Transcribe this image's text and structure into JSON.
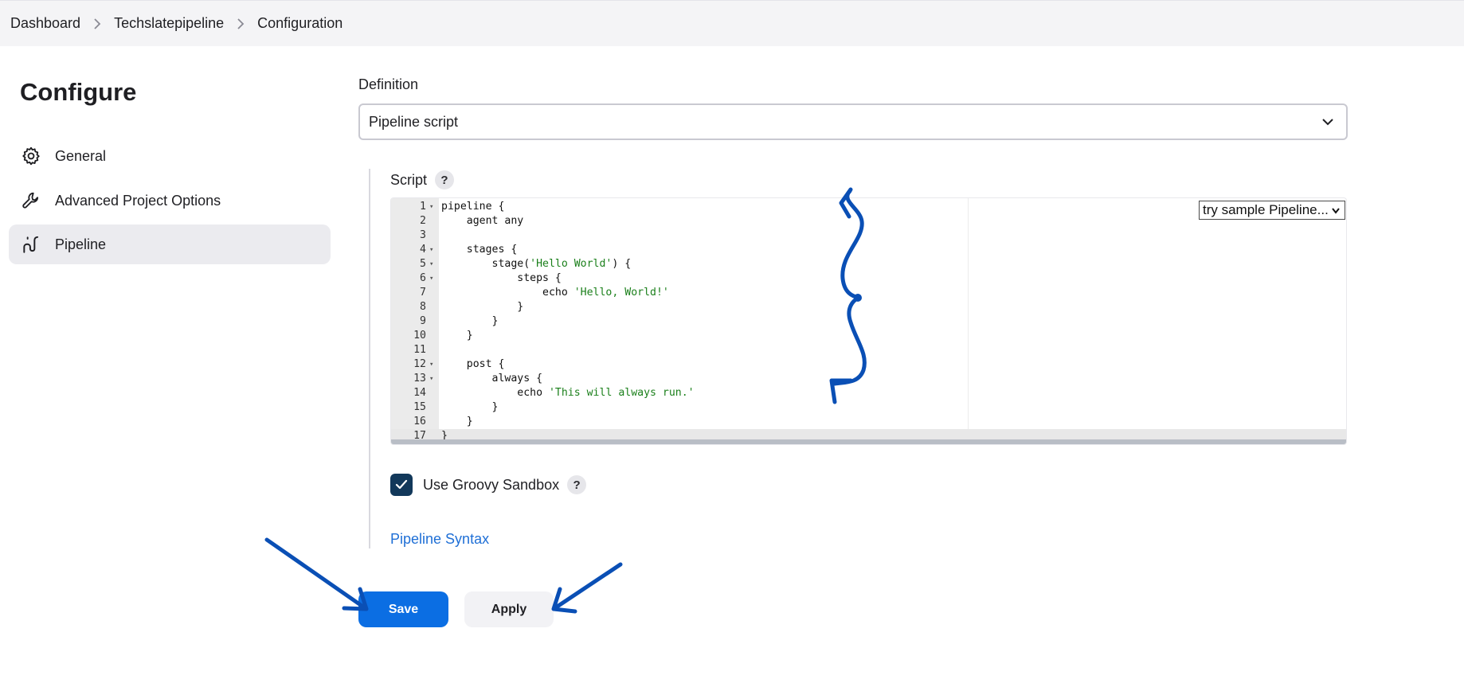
{
  "breadcrumb": {
    "items": [
      "Dashboard",
      "Techslatepipeline",
      "Configuration"
    ]
  },
  "sidebar": {
    "title": "Configure",
    "items": [
      {
        "label": "General",
        "icon": "gear-icon"
      },
      {
        "label": "Advanced Project Options",
        "icon": "wrench-icon"
      },
      {
        "label": "Pipeline",
        "icon": "pipeline-icon",
        "active": true
      }
    ]
  },
  "definition": {
    "label": "Definition",
    "selected": "Pipeline script"
  },
  "script": {
    "label": "Script",
    "help": "?",
    "sample_select": "try sample Pipeline...",
    "lines": [
      {
        "n": "1",
        "code": "pipeline {"
      },
      {
        "n": "2",
        "code": "    agent any"
      },
      {
        "n": "3",
        "code": ""
      },
      {
        "n": "4",
        "code": "    stages {"
      },
      {
        "n": "5",
        "code": "        stage('Hello World') {"
      },
      {
        "n": "6",
        "code": "            steps {"
      },
      {
        "n": "7",
        "code": "                echo 'Hello, World!'"
      },
      {
        "n": "8",
        "code": "            }"
      },
      {
        "n": "9",
        "code": "        }"
      },
      {
        "n": "10",
        "code": "    }"
      },
      {
        "n": "11",
        "code": ""
      },
      {
        "n": "12",
        "code": "    post {"
      },
      {
        "n": "13",
        "code": "        always {"
      },
      {
        "n": "14",
        "code": "            echo 'This will always run.'"
      },
      {
        "n": "15",
        "code": "        }"
      },
      {
        "n": "16",
        "code": "    }"
      },
      {
        "n": "17",
        "code": "}"
      }
    ]
  },
  "sandbox": {
    "label": "Use Groovy Sandbox",
    "checked": true,
    "help": "?"
  },
  "pipeline_syntax_link": "Pipeline Syntax",
  "buttons": {
    "save": "Save",
    "apply": "Apply"
  },
  "colors": {
    "primary": "#0b6ee3",
    "link": "#1f6fd6",
    "checkbox": "#12385a",
    "annotation": "#0a4fb5"
  }
}
